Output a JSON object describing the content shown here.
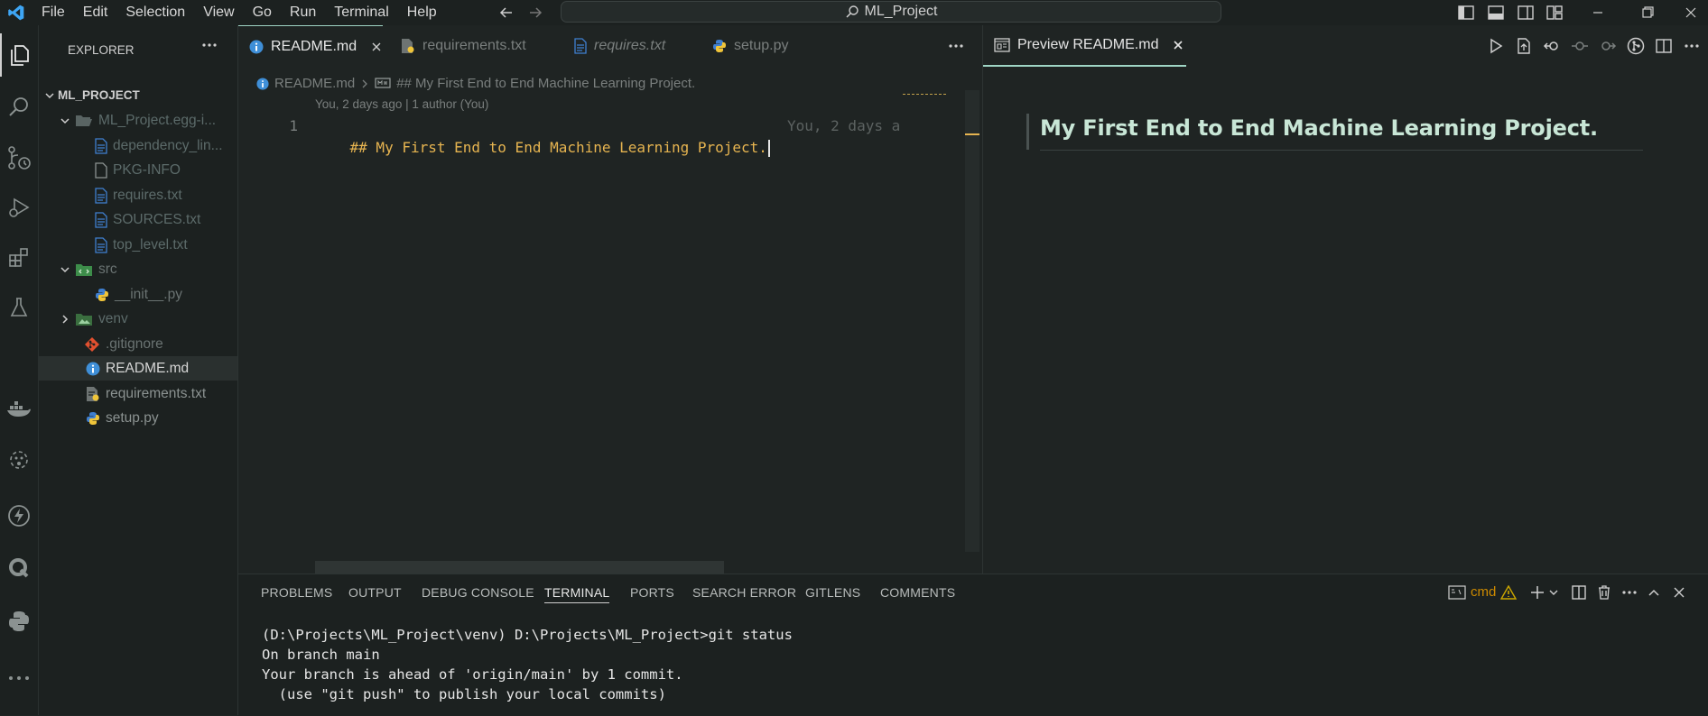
{
  "titlebar": {
    "menus": [
      "File",
      "Edit",
      "Selection",
      "View",
      "Go",
      "Run",
      "Terminal",
      "Help"
    ],
    "search_text": "ML_Project"
  },
  "sidebar": {
    "title": "EXPLORER",
    "project": "ML_PROJECT",
    "items": [
      {
        "label": "ML_Project.egg-i...",
        "color": "#5c6b6a"
      },
      {
        "label": "dependency_lin...",
        "color": "#5c6b6a"
      },
      {
        "label": "PKG-INFO",
        "color": "#5c6b6a"
      },
      {
        "label": "requires.txt",
        "color": "#5c6b6a"
      },
      {
        "label": "SOURCES.txt",
        "color": "#5c6b6a"
      },
      {
        "label": "top_level.txt",
        "color": "#5c6b6a"
      },
      {
        "label": "src",
        "color": "#6a7372"
      },
      {
        "label": "__init__.py",
        "color": "#6a7372"
      },
      {
        "label": "venv",
        "color": "#5c6b6a"
      },
      {
        "label": ".gitignore",
        "color": "#6a7372"
      },
      {
        "label": "README.md",
        "color": "#d6d6d6"
      },
      {
        "label": "requirements.txt",
        "color": "#8b9291"
      },
      {
        "label": "setup.py",
        "color": "#8b9291"
      }
    ]
  },
  "editor": {
    "tabs": [
      "README.md",
      "requirements.txt",
      "requires.txt",
      "setup.py"
    ],
    "breadcrumb_file": "README.md",
    "breadcrumb_section": "## My First End to End Machine Learning Project.",
    "codelens": "You, 2 days ago | 1 author (You)",
    "line_number": "1",
    "line_text": "## My First End to End Machine Learning Project.",
    "blame": "You, 2 days a"
  },
  "preview": {
    "tab": "Preview README.md",
    "heading": "My First End to End Machine Learning Project."
  },
  "panel": {
    "tabs": [
      "PROBLEMS",
      "OUTPUT",
      "DEBUG CONSOLE",
      "TERMINAL",
      "PORTS",
      "SEARCH ERROR",
      "GITLENS",
      "COMMENTS"
    ],
    "terminal_name": "cmd",
    "lines": [
      "(D:\\Projects\\ML_Project\\venv) D:\\Projects\\ML_Project>git status",
      "On branch main",
      "Your branch is ahead of 'origin/main' by 1 commit.",
      "  (use \"git push\" to publish your local commits)"
    ]
  },
  "colors": {
    "accent": "#0078d4",
    "heading": "#c8e6d6",
    "code_text": "#e6b450",
    "warning": "#cca700"
  }
}
